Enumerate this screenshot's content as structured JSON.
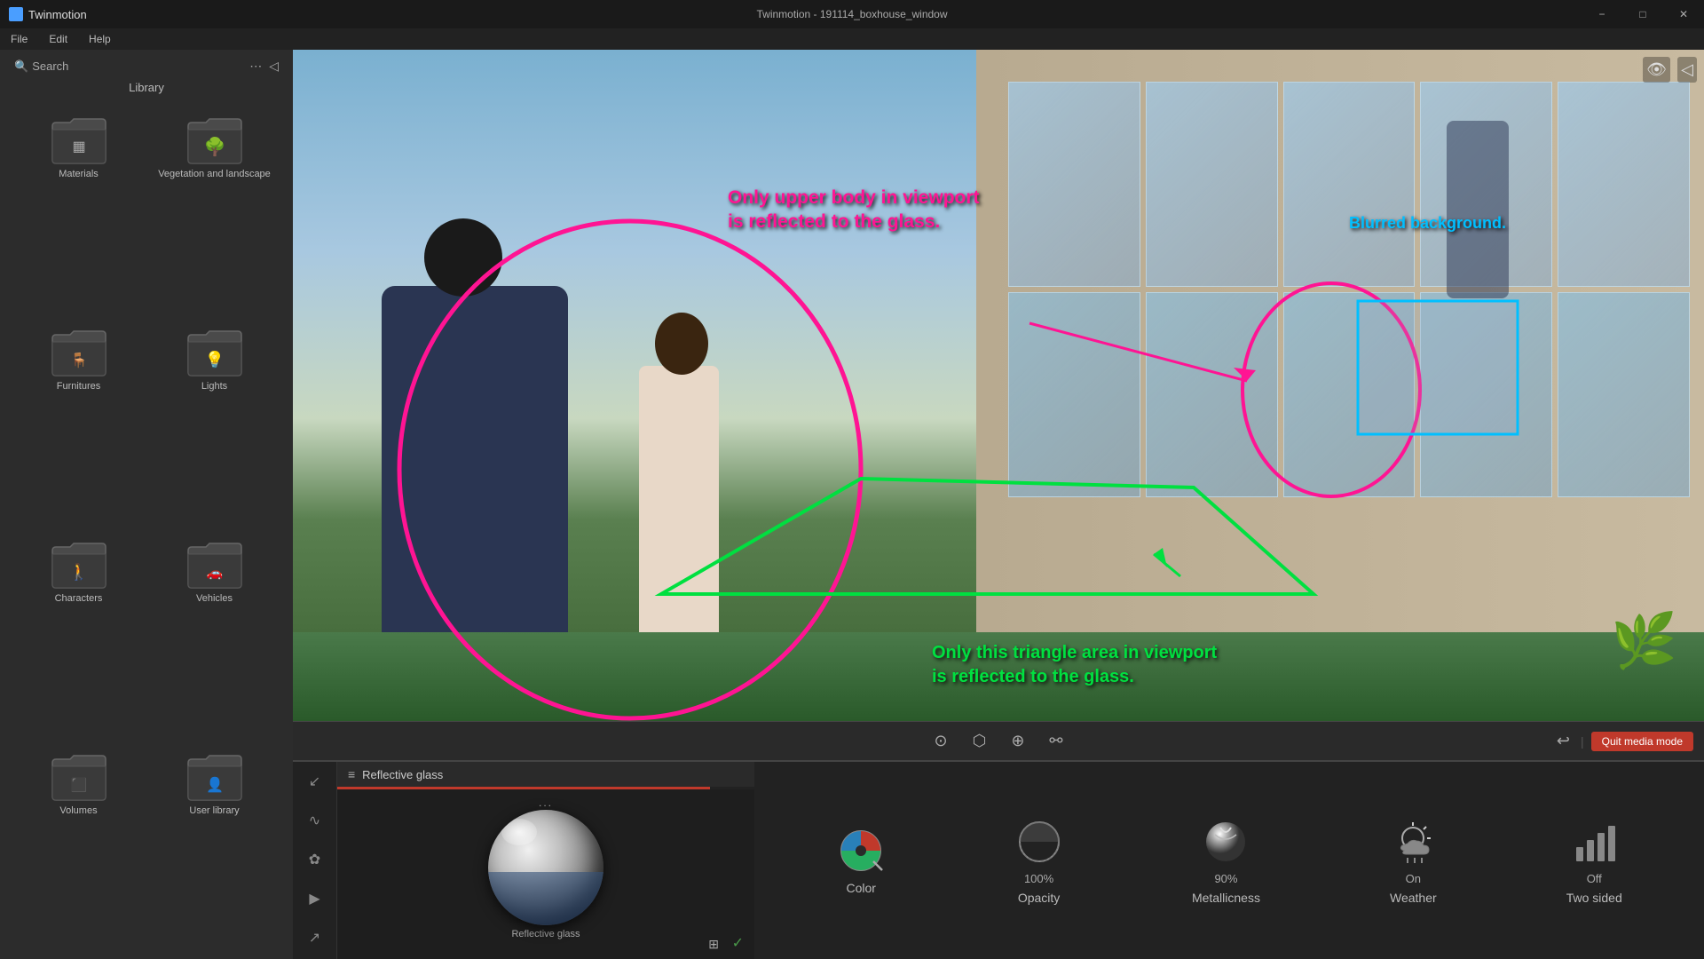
{
  "app": {
    "title": "Twinmotion",
    "window_title": "Twinmotion - 191114_boxhouse_window",
    "min_label": "−",
    "max_label": "□",
    "close_label": "✕",
    "restore_label": "❐"
  },
  "menu": {
    "items": [
      "File",
      "Edit",
      "Help"
    ]
  },
  "sidebar": {
    "search_label": "Search",
    "library_label": "Library",
    "items": [
      {
        "id": "materials",
        "label": "Materials"
      },
      {
        "id": "vegetation",
        "label": "Vegetation and landscape"
      },
      {
        "id": "furnitures",
        "label": "Furnitures"
      },
      {
        "id": "lights",
        "label": "Lights"
      },
      {
        "id": "characters",
        "label": "Characters"
      },
      {
        "id": "vehicles",
        "label": "Vehicles"
      },
      {
        "id": "volumes",
        "label": "Volumes"
      },
      {
        "id": "user-library",
        "label": "User library"
      }
    ]
  },
  "viewport": {
    "annotations": {
      "upper_body_text": "Only upper body in viewport",
      "upper_body_text2": "is reflected to the glass.",
      "blurred_bg_text": "Blurred background.",
      "triangle_text": "Only this triangle area in viewport",
      "triangle_text2": "is reflected to the glass."
    }
  },
  "toolbar": {
    "quit_media_label": "Quit media mode"
  },
  "material_panel": {
    "title": "Reflective glass",
    "selected_material": "Reflective glass",
    "dots": "...",
    "checkmark": "✓"
  },
  "properties": {
    "color": {
      "label": "Color",
      "value": ""
    },
    "opacity": {
      "label": "Opacity",
      "value": "100%"
    },
    "metallicness": {
      "label": "Metallicness",
      "value": "90%"
    },
    "weather": {
      "label": "Weather",
      "value": "On"
    },
    "two_sided": {
      "label": "Two sided",
      "value": "Off"
    }
  },
  "icons": {
    "search": "🔍",
    "more": "⋯",
    "collapse": "◁",
    "eye": "👁",
    "layers": "⊞",
    "hamburger": "≡",
    "grid": "⊞",
    "import": "↙",
    "graph": "∿",
    "leaf": "✿",
    "play": "▶",
    "export": "↗",
    "lasso": "⊙",
    "paint": "⬡",
    "move": "⊕",
    "link": "⚯",
    "back": "↩"
  }
}
